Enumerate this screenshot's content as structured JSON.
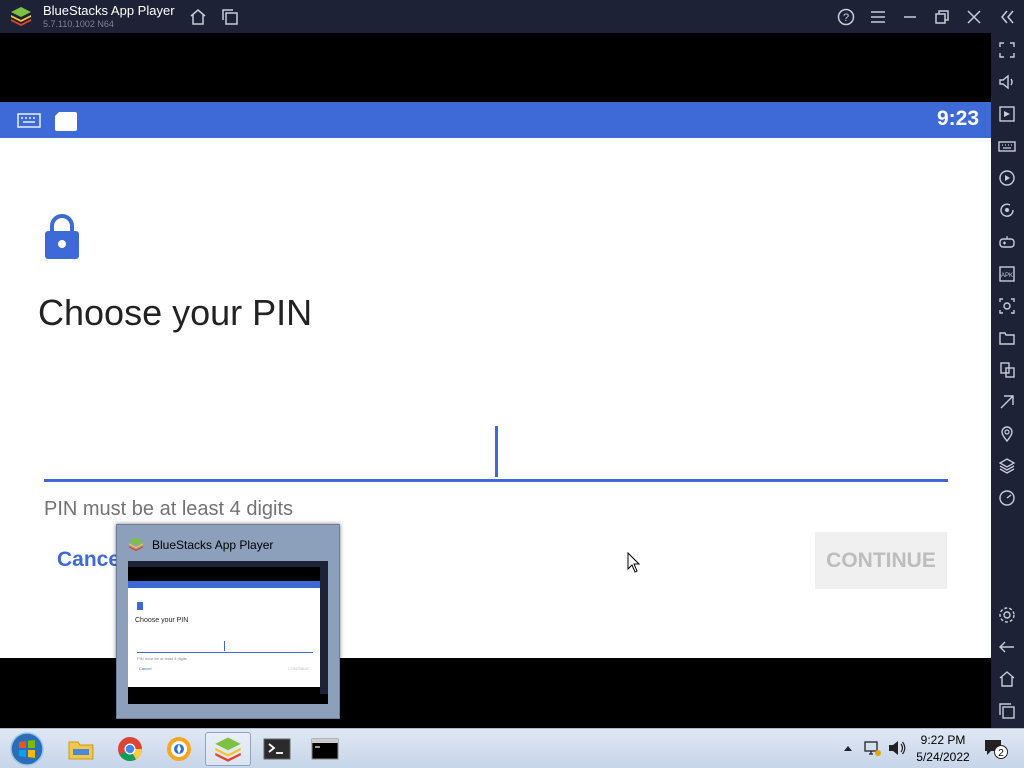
{
  "window": {
    "title": "BlueStacks App Player",
    "version": "5.7.110.1002 N64"
  },
  "android": {
    "clock": "9:23",
    "title": "Choose your PIN",
    "hint": "PIN must be at least 4 digits",
    "cancel_label": "Cancel",
    "continue_label": "CONTINUE"
  },
  "preview": {
    "title": "BlueStacks App Player",
    "thumb_title": "Choose your PIN",
    "thumb_hint": "PIN must be at least 4 digits",
    "thumb_cancel": "Cancel",
    "thumb_continue": "CONTINUE"
  },
  "taskbar": {
    "time": "9:22 PM",
    "date": "5/24/2022",
    "notifications": "2"
  },
  "colors": {
    "accent": "#3d6ad6",
    "chrome": "#1e2236"
  }
}
